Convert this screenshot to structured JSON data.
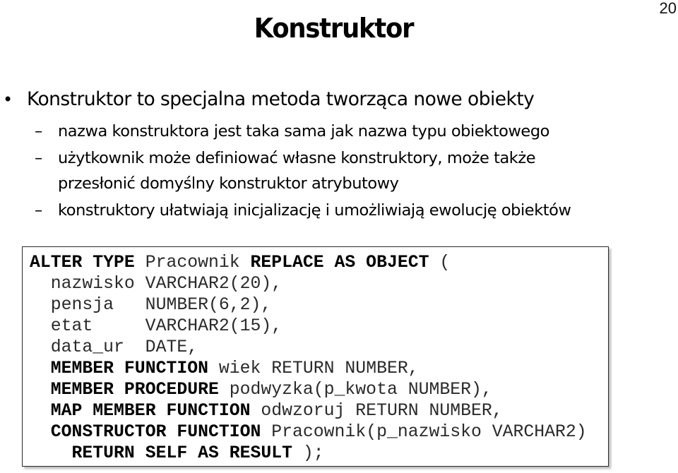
{
  "slide": {
    "page_number": "20",
    "title": "Konstruktor"
  },
  "bullets": {
    "main": {
      "marker": "•",
      "text": "Konstruktor to specjalna metoda tworząca nowe obiekty"
    },
    "sub": [
      {
        "marker": "–",
        "lines": [
          "nazwa konstruktora jest taka sama jak nazwa typu obiektowego"
        ]
      },
      {
        "marker": "–",
        "lines": [
          "użytkownik może definiować własne konstruktory, może także",
          "przesłonić domyślny konstruktor atrybutowy"
        ]
      },
      {
        "marker": "–",
        "lines": [
          "konstruktory ułatwiają inicjalizację i umożliwiają ewolucję obiektów"
        ]
      }
    ]
  },
  "code": {
    "lines": [
      [
        {
          "t": "ALTER TYPE",
          "b": true
        },
        {
          "t": " Pracownik ",
          "b": false
        },
        {
          "t": "REPLACE AS OBJECT",
          "b": true
        },
        {
          "t": " (",
          "b": false
        }
      ],
      [
        {
          "t": "  nazwisko VARCHAR2(20),",
          "b": false
        }
      ],
      [
        {
          "t": "  pensja   NUMBER(6,2),",
          "b": false
        }
      ],
      [
        {
          "t": "  etat     VARCHAR2(15),",
          "b": false
        }
      ],
      [
        {
          "t": "  data_ur  DATE,",
          "b": false
        }
      ],
      [
        {
          "t": "  ",
          "b": false
        },
        {
          "t": "MEMBER FUNCTION",
          "b": true
        },
        {
          "t": " wiek RETURN NUMBER,",
          "b": false
        }
      ],
      [
        {
          "t": "  ",
          "b": false
        },
        {
          "t": "MEMBER PROCEDURE",
          "b": true
        },
        {
          "t": " podwyzka(p_kwota NUMBER),",
          "b": false
        }
      ],
      [
        {
          "t": "  ",
          "b": false
        },
        {
          "t": "MAP MEMBER FUNCTION",
          "b": true
        },
        {
          "t": " odwzoruj RETURN NUMBER,",
          "b": false
        }
      ],
      [
        {
          "t": "  ",
          "b": false
        },
        {
          "t": "CONSTRUCTOR FUNCTION",
          "b": true
        },
        {
          "t": " Pracownik(p_nazwisko VARCHAR2)",
          "b": false
        }
      ],
      [
        {
          "t": "    ",
          "b": false
        },
        {
          "t": "RETURN SELF AS RESULT",
          "b": true
        },
        {
          "t": " );",
          "b": false
        }
      ]
    ]
  }
}
